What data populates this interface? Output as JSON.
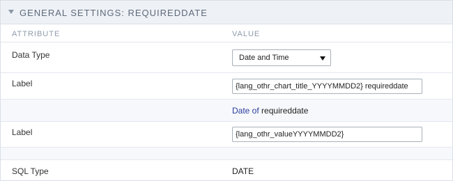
{
  "panel": {
    "title": "GENERAL SETTINGS: REQUIREDDATE",
    "columns": {
      "attribute": "ATTRIBUTE",
      "value": "VALUE"
    }
  },
  "rows": {
    "data_type": {
      "label": "Data Type",
      "selected": "Date and Time"
    },
    "label1": {
      "label": "Label",
      "value": "{lang_othr_chart_title_YYYYMMDD2} requireddate"
    },
    "preview": {
      "prefix": "Date of",
      "field": "requireddate"
    },
    "label2": {
      "label": "Label",
      "value": "{lang_othr_valueYYYYMMDD2}"
    },
    "sql_type": {
      "label": "SQL Type",
      "value": "DATE"
    }
  },
  "colors": {
    "header_bg": "#eef1f6",
    "accent": "#2a3c9e",
    "row_shade": "#f6f8fb"
  },
  "icons": {
    "collapse": "caret-down-icon",
    "select": "chevron-down-icon"
  }
}
